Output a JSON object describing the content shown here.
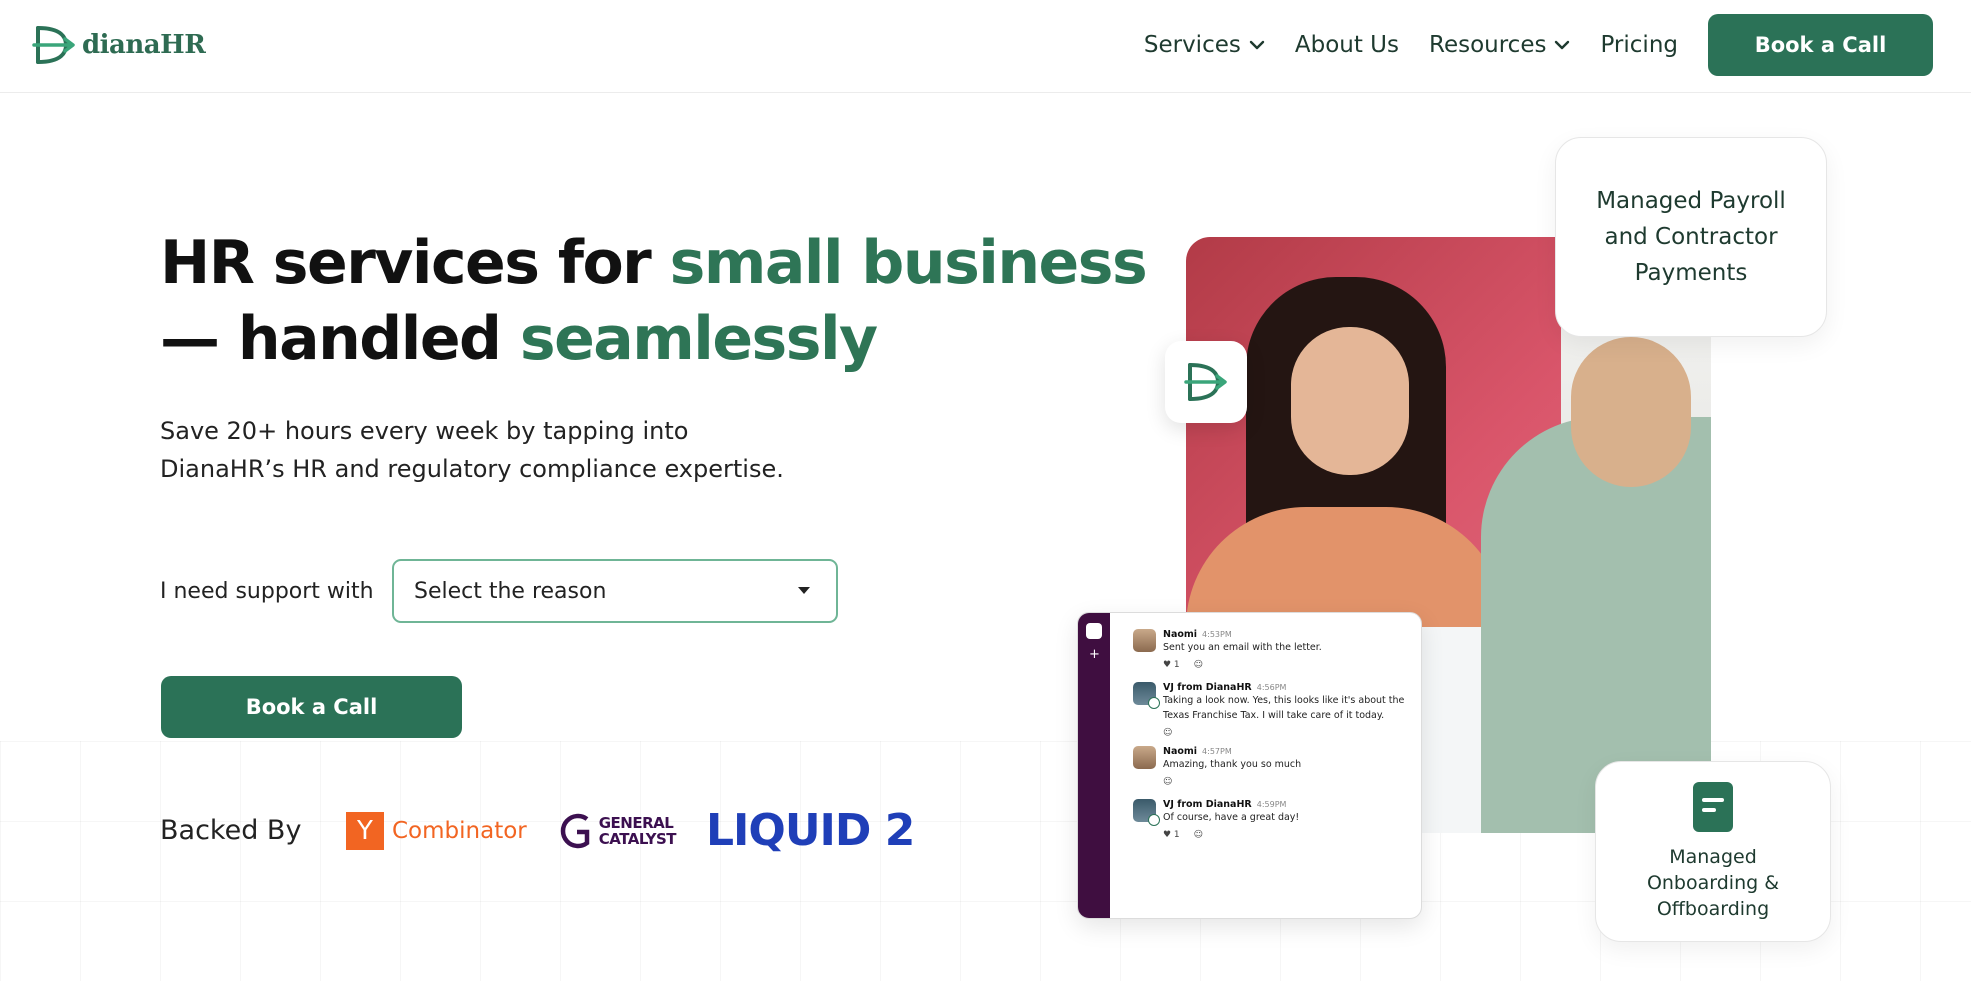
{
  "brand": {
    "name": "dianaHR",
    "accent": "#2b7257"
  },
  "nav": {
    "items": [
      {
        "label": "Services",
        "dropdown": true
      },
      {
        "label": "About Us",
        "dropdown": false
      },
      {
        "label": "Resources",
        "dropdown": true
      },
      {
        "label": "Pricing",
        "dropdown": false
      }
    ],
    "cta": "Book a Call"
  },
  "hero": {
    "title_part1": "HR services for ",
    "title_highlight1": "small business",
    "title_part2": "— handled ",
    "title_highlight2": "seamlessly",
    "subtitle_line1": "Save 20+ hours every week by tapping into",
    "subtitle_line2": "DianaHR’s HR and regulatory compliance expertise.",
    "support_label": "I need support with",
    "select_value": "Select the reason",
    "cta": "Book a Call"
  },
  "backed": {
    "label": "Backed By",
    "investors": [
      {
        "name": "Y Combinator",
        "mark": "Y",
        "text": "Combinator"
      },
      {
        "name": "General Catalyst",
        "line1": "GENERAL",
        "line2": "CATALYST"
      },
      {
        "name": "Liquid 2",
        "text": "LIQUID 2"
      }
    ]
  },
  "cards": {
    "payroll": [
      "Managed Payroll",
      "and Contractor",
      "Payments"
    ],
    "onboarding": [
      "Managed",
      "Onboarding &",
      "Offboarding"
    ]
  },
  "chat": {
    "messages": [
      {
        "name": "Naomi",
        "time": "4:53PM",
        "lines": [
          "Sent you an email with the letter."
        ],
        "reactions": [
          "♥ 1",
          "☺"
        ]
      },
      {
        "name": "VJ from DianaHR",
        "time": "4:56PM",
        "lines": [
          "Taking a look now. Yes, this looks like it's about the",
          "Texas Franchise Tax. I will take care of it today."
        ],
        "reactions": [
          "☺"
        ]
      },
      {
        "name": "Naomi",
        "time": "4:57PM",
        "lines": [
          "Amazing, thank you so much"
        ],
        "reactions": [
          "☺"
        ]
      },
      {
        "name": "VJ from DianaHR",
        "time": "4:59PM",
        "lines": [
          "Of course, have a great day!"
        ],
        "reactions": [
          "♥ 1",
          "☺"
        ]
      }
    ]
  }
}
